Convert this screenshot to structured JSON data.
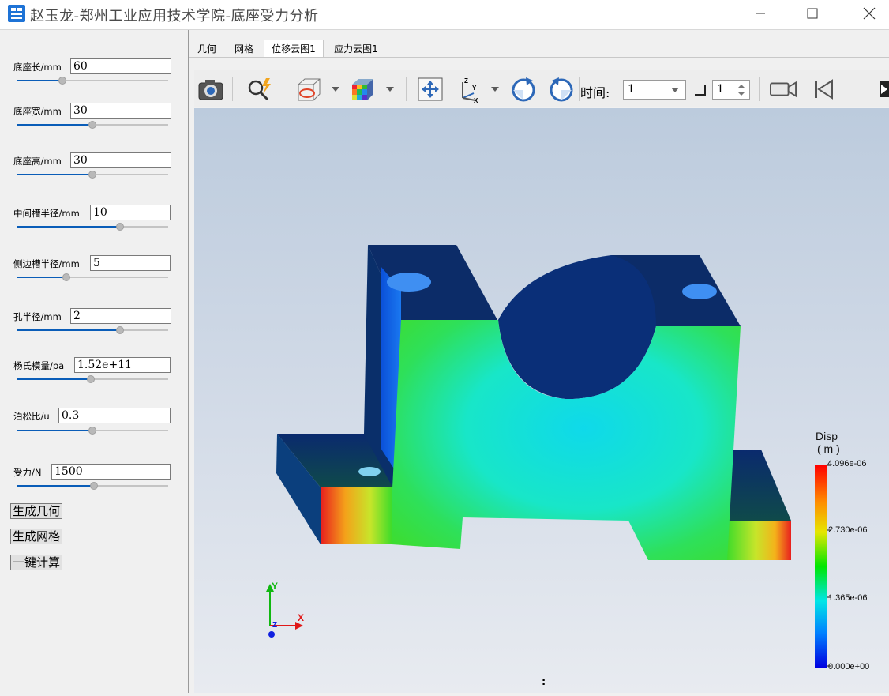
{
  "window": {
    "title": "赵玉龙-郑州工业应用技术学院-底座受力分析",
    "controls": {
      "minimize": "minimize-icon",
      "maximize": "maximize-icon",
      "close": "close-icon"
    }
  },
  "params": [
    {
      "label": "底座长/mm",
      "value": "60",
      "slider": 0.3
    },
    {
      "label": "底座宽/mm",
      "value": "30",
      "slider": 0.5
    },
    {
      "label": "底座高/mm",
      "value": "30",
      "slider": 0.5
    },
    {
      "label": "中间槽半径/mm",
      "value": "10",
      "slider": 0.68
    },
    {
      "label": "侧边槽半径/mm",
      "value": "5",
      "slider": 0.33
    },
    {
      "label": "孔半径/mm",
      "value": "2",
      "slider": 0.68
    },
    {
      "label": "杨氏模量/pa",
      "value": "1.52e+11",
      "slider": 0.49
    },
    {
      "label": "泊松比/u",
      "value": "0.3",
      "slider": 0.5
    },
    {
      "label": "受力/N",
      "value": "1500",
      "slider": 0.51
    }
  ],
  "buttons": {
    "gen_geometry": "生成几何",
    "gen_mesh": "生成网格",
    "compute": "一键计算"
  },
  "tabs": [
    "几何",
    "网格",
    "位移云图1",
    "应力云图1"
  ],
  "active_tab": 2,
  "toolbar": {
    "time_label": "时间:",
    "time_value": "1",
    "step_value": "1",
    "icons": [
      "camera-icon",
      "zoom-probe-icon",
      "clip-volume-icon",
      "color-cube-icon",
      "reset-view-icon",
      "axes-orient-icon",
      "rotate-cw-icon",
      "rotate-ccw-icon",
      "video-camera-icon",
      "first-frame-icon",
      "play-icon"
    ]
  },
  "legend": {
    "title": "Disp",
    "unit": "( m )",
    "ticks": [
      "4.096e-06",
      "2.730e-06",
      "1.365e-06",
      "0.000e+00"
    ]
  },
  "axes": {
    "x": "X",
    "y": "Y",
    "z": "Z"
  },
  "status_mark": ":"
}
